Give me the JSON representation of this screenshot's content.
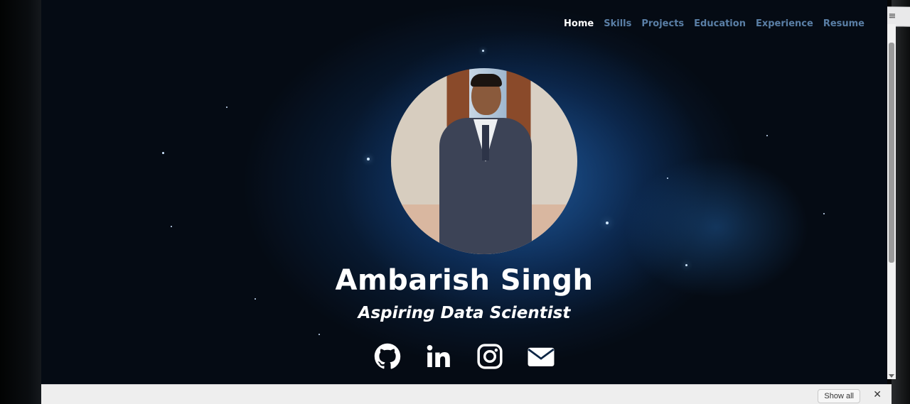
{
  "nav": {
    "items": [
      {
        "label": "Home",
        "active": true
      },
      {
        "label": "Skills",
        "active": false
      },
      {
        "label": "Projects",
        "active": false
      },
      {
        "label": "Education",
        "active": false
      },
      {
        "label": "Experience",
        "active": false
      },
      {
        "label": "Resume",
        "active": false
      }
    ]
  },
  "hero": {
    "name": "Ambarish Singh",
    "title": "Aspiring Data Scientist"
  },
  "socials": [
    {
      "icon": "github-icon"
    },
    {
      "icon": "linkedin-icon"
    },
    {
      "icon": "instagram-icon"
    },
    {
      "icon": "email-icon"
    }
  ],
  "downloads_bar": {
    "show_all_label": "Show all",
    "close_label": "✕"
  },
  "colors": {
    "nav_active": "#ffffff",
    "nav_inactive": "#5a7fa6",
    "background": "#05090f",
    "accent_nebula": "#1e5aa0"
  }
}
